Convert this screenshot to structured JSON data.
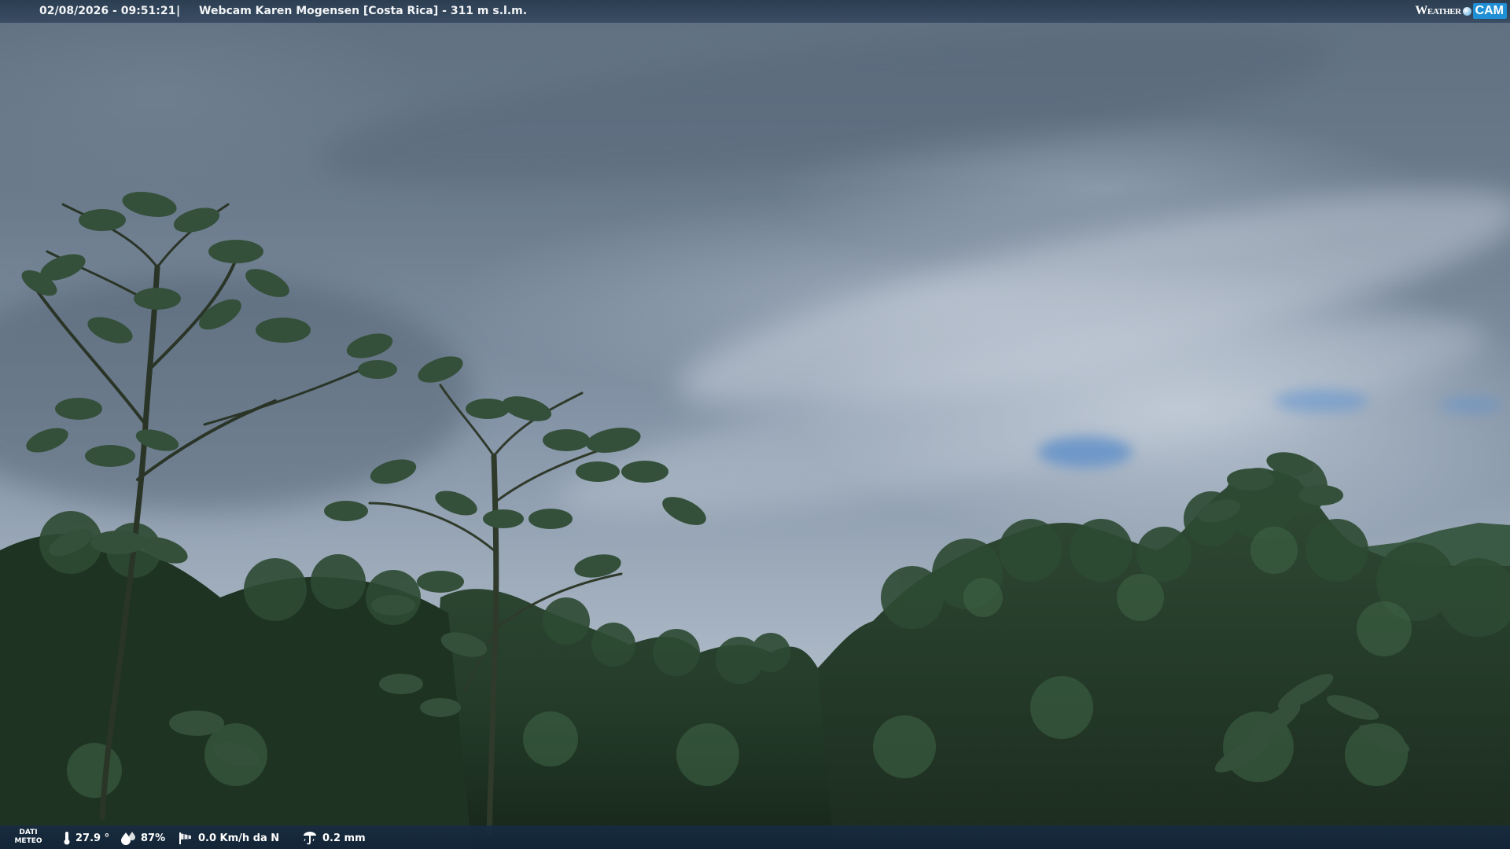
{
  "overlay": {
    "timestamp": "02/08/2026 - 09:51:21",
    "separator": "|",
    "title": "Webcam Karen Mogensen [Costa Rica]  - 311 m s.l.m.",
    "logo": {
      "weather": "Weather",
      "cam": "CAM"
    }
  },
  "weather_bar": {
    "label_line1": "DATI",
    "label_line2": "METEO",
    "temperature": "27.9 °",
    "humidity": "87%",
    "wind": "0.0 Km/h da N",
    "rain": "0.2 mm"
  },
  "icons": {
    "temperature": "thermometer-icon",
    "humidity": "humidity-drops-icon",
    "wind": "windsock-icon",
    "rain": "rain-gauge-icon"
  },
  "colors": {
    "bar_background": "#283a4e",
    "logo_accent": "#1f8fd6",
    "text": "#ffffff"
  }
}
